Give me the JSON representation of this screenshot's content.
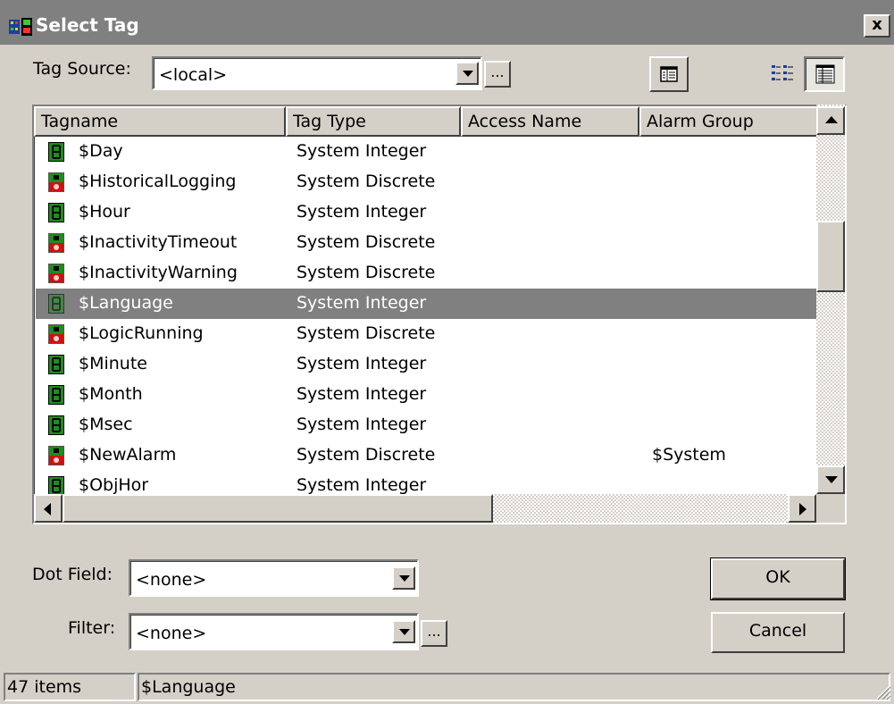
{
  "window": {
    "title": "Select Tag",
    "close_label": "x"
  },
  "tag_source": {
    "label": "Tag Source:",
    "value": "<local>",
    "browse_label": "..."
  },
  "toolbar": {
    "view_icons": [
      "tree-view-icon",
      "list-view-icon",
      "details-view-icon"
    ]
  },
  "columns": [
    "Tagname",
    "Tag Type",
    "Access Name",
    "Alarm Group"
  ],
  "rows": [
    {
      "name": "$Day",
      "type": "System Integer",
      "access": "",
      "alarm": "",
      "icon": "integer-tag-icon"
    },
    {
      "name": "$HistoricalLogging",
      "type": "System Discrete",
      "access": "",
      "alarm": "",
      "icon": "discrete-tag-icon"
    },
    {
      "name": "$Hour",
      "type": "System Integer",
      "access": "",
      "alarm": "",
      "icon": "integer-tag-icon"
    },
    {
      "name": "$InactivityTimeout",
      "type": "System Discrete",
      "access": "",
      "alarm": "",
      "icon": "discrete-tag-icon"
    },
    {
      "name": "$InactivityWarning",
      "type": "System Discrete",
      "access": "",
      "alarm": "",
      "icon": "discrete-tag-icon"
    },
    {
      "name": "$Language",
      "type": "System Integer",
      "access": "",
      "alarm": "",
      "icon": "integer-tag-icon",
      "selected": true
    },
    {
      "name": "$LogicRunning",
      "type": "System Discrete",
      "access": "",
      "alarm": "",
      "icon": "discrete-tag-icon"
    },
    {
      "name": "$Minute",
      "type": "System Integer",
      "access": "",
      "alarm": "",
      "icon": "integer-tag-icon"
    },
    {
      "name": "$Month",
      "type": "System Integer",
      "access": "",
      "alarm": "",
      "icon": "integer-tag-icon"
    },
    {
      "name": "$Msec",
      "type": "System Integer",
      "access": "",
      "alarm": "",
      "icon": "integer-tag-icon"
    },
    {
      "name": "$NewAlarm",
      "type": "System Discrete",
      "access": "",
      "alarm": "$System",
      "icon": "discrete-tag-icon"
    },
    {
      "name": "$ObjHor",
      "type": "System Integer",
      "access": "",
      "alarm": "",
      "icon": "integer-tag-icon"
    }
  ],
  "dot_field": {
    "label": "Dot Field:",
    "value": "<none>"
  },
  "filter": {
    "label": "Filter:",
    "value": "<none>",
    "browse_label": "..."
  },
  "buttons": {
    "ok": "OK",
    "cancel": "Cancel"
  },
  "status": {
    "count": "47 items",
    "selection": "$Language"
  },
  "colors": {
    "selected_row": "#808080",
    "face": "#d4d0c8",
    "integer_icon": "#1a8f1a",
    "discrete_icon": "#d01010"
  }
}
